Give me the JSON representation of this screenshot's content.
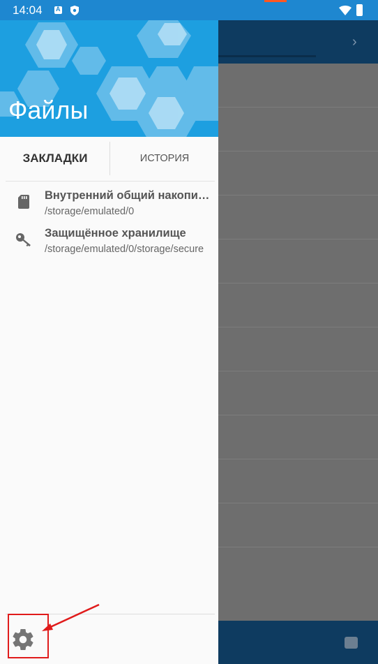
{
  "status_bar": {
    "time": "14:04",
    "icons": [
      "accessibility-icon",
      "shield-icon",
      "wifi-icon",
      "battery-icon"
    ]
  },
  "drawer": {
    "title": "Файлы",
    "tabs": [
      {
        "label": "Закладки",
        "selected": true
      },
      {
        "label": "История",
        "selected": false
      }
    ],
    "bookmarks": [
      {
        "icon": "sd-card-icon",
        "title": "Внутренний общий накопитель",
        "path": "/storage/emulated/0"
      },
      {
        "icon": "key-icon",
        "title": "Защищённое хранилище",
        "path": "/storage/emulated/0/storage/secure"
      }
    ],
    "settings_icon": "gear-icon"
  },
  "colors": {
    "header_blue": "#1d9fe0",
    "toolbar_dark": "#0e3b60",
    "annotation_red": "#e01b1b"
  }
}
